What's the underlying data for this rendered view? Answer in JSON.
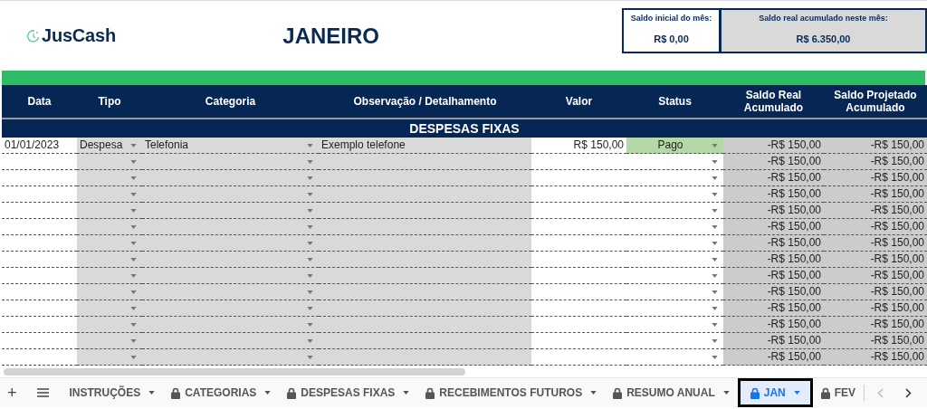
{
  "logo": {
    "text": "JusCash"
  },
  "title": "JANEIRO",
  "summary": [
    {
      "label": "Saldo inicial do mês:",
      "value": "R$ 0,00",
      "kind": "white"
    },
    {
      "label": "Saldo real acumulado neste mês:",
      "value": "R$ 6.350,00",
      "kind": "grey"
    }
  ],
  "table": {
    "columns": [
      "Data",
      "Tipo",
      "Categoria",
      "Observação / Detalhamento",
      "Valor",
      "Status",
      "Saldo Real Acumulado",
      "Saldo Projetado Acumulado"
    ],
    "section": "DESPESAS FIXAS",
    "rows": [
      {
        "date": "01/01/2023",
        "tipo": "Despesa",
        "categoria": "Telefonia",
        "observacao": "Exemplo telefone",
        "valor": "R$ 150,00",
        "status": {
          "label": "Pago",
          "color": "#b6d7a8"
        },
        "saldo_real": "-R$ 150,00",
        "saldo_projetado": "-R$ 150,00"
      },
      {
        "saldo_real": "-R$ 150,00",
        "saldo_projetado": "-R$ 150,00"
      },
      {
        "saldo_real": "-R$ 150,00",
        "saldo_projetado": "-R$ 150,00"
      },
      {
        "saldo_real": "-R$ 150,00",
        "saldo_projetado": "-R$ 150,00"
      },
      {
        "saldo_real": "-R$ 150,00",
        "saldo_projetado": "-R$ 150,00"
      },
      {
        "saldo_real": "-R$ 150,00",
        "saldo_projetado": "-R$ 150,00"
      },
      {
        "saldo_real": "-R$ 150,00",
        "saldo_projetado": "-R$ 150,00"
      },
      {
        "saldo_real": "-R$ 150,00",
        "saldo_projetado": "-R$ 150,00"
      },
      {
        "saldo_real": "-R$ 150,00",
        "saldo_projetado": "-R$ 150,00"
      },
      {
        "saldo_real": "-R$ 150,00",
        "saldo_projetado": "-R$ 150,00"
      },
      {
        "saldo_real": "-R$ 150,00",
        "saldo_projetado": "-R$ 150,00"
      },
      {
        "saldo_real": "-R$ 150,00",
        "saldo_projetado": "-R$ 150,00"
      },
      {
        "saldo_real": "-R$ 150,00",
        "saldo_projetado": "-R$ 150,00"
      },
      {
        "saldo_real": "-R$ 150,00",
        "saldo_projetado": "-R$ 150,00"
      }
    ]
  },
  "add_sheet": "+",
  "sheet_tabs": [
    {
      "label": "INSTRUÇÕES",
      "locked": false,
      "menu": true,
      "selected": false
    },
    {
      "label": "CATEGORIAS",
      "locked": true,
      "menu": true,
      "selected": false
    },
    {
      "label": "DESPESAS FIXAS",
      "locked": true,
      "menu": true,
      "selected": false
    },
    {
      "label": "RECEBIMENTOS FUTUROS",
      "locked": true,
      "menu": true,
      "selected": false
    },
    {
      "label": "RESUMO ANUAL",
      "locked": true,
      "menu": true,
      "selected": false
    },
    {
      "label": "JAN",
      "locked": true,
      "menu": true,
      "selected": true
    },
    {
      "label": "FEV",
      "locked": true,
      "menu": false,
      "selected": false
    }
  ]
}
